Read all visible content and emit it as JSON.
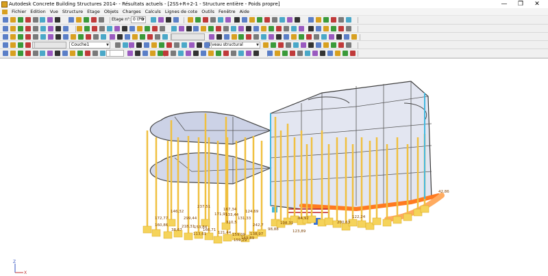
{
  "window": {
    "title": "Autodesk Concrete Building Structures 2014- - Résultats actuels - [2SS+R+2-1 - Structure entière - Poids propre]",
    "minimize": "—",
    "restore": "❐",
    "close": "✕"
  },
  "menu": [
    "Fichier",
    "Edition",
    "Vue",
    "Structure",
    "Etage",
    "Objets",
    "Charges",
    "Calculs",
    "Lignes de cote",
    "Outils",
    "Fenêtre",
    "Aide"
  ],
  "toolbar": {
    "floor_label": "Etage n°:",
    "floor_value": "0 (PO",
    "layer_value": "Couche1",
    "level_value": "Niveau structural"
  },
  "colors": {
    "column": "#f0c040",
    "footing": "#f5d35a",
    "slab": "#ccd2e6",
    "beam": "#3a3a3a",
    "accent_column": "#40b8e0",
    "highlight": "#ff7a20",
    "label": "#7a3e00"
  },
  "result_labels": [
    "172,77",
    "146,32",
    "237,51",
    "167,34",
    "124,69",
    "42,86",
    "160,86",
    "299,44",
    "171,91",
    "133,44",
    "131,33",
    "38,67",
    "218,31",
    "153,84",
    "166,71",
    "310,5",
    "108,31",
    "98,88",
    "159,09",
    "242,7",
    "138,97",
    "200,63",
    "122,24",
    "113,61",
    "121,44",
    "159,29",
    "169,89",
    "123,89",
    "84,92"
  ],
  "axis": {
    "z": "Z",
    "x": "X"
  }
}
